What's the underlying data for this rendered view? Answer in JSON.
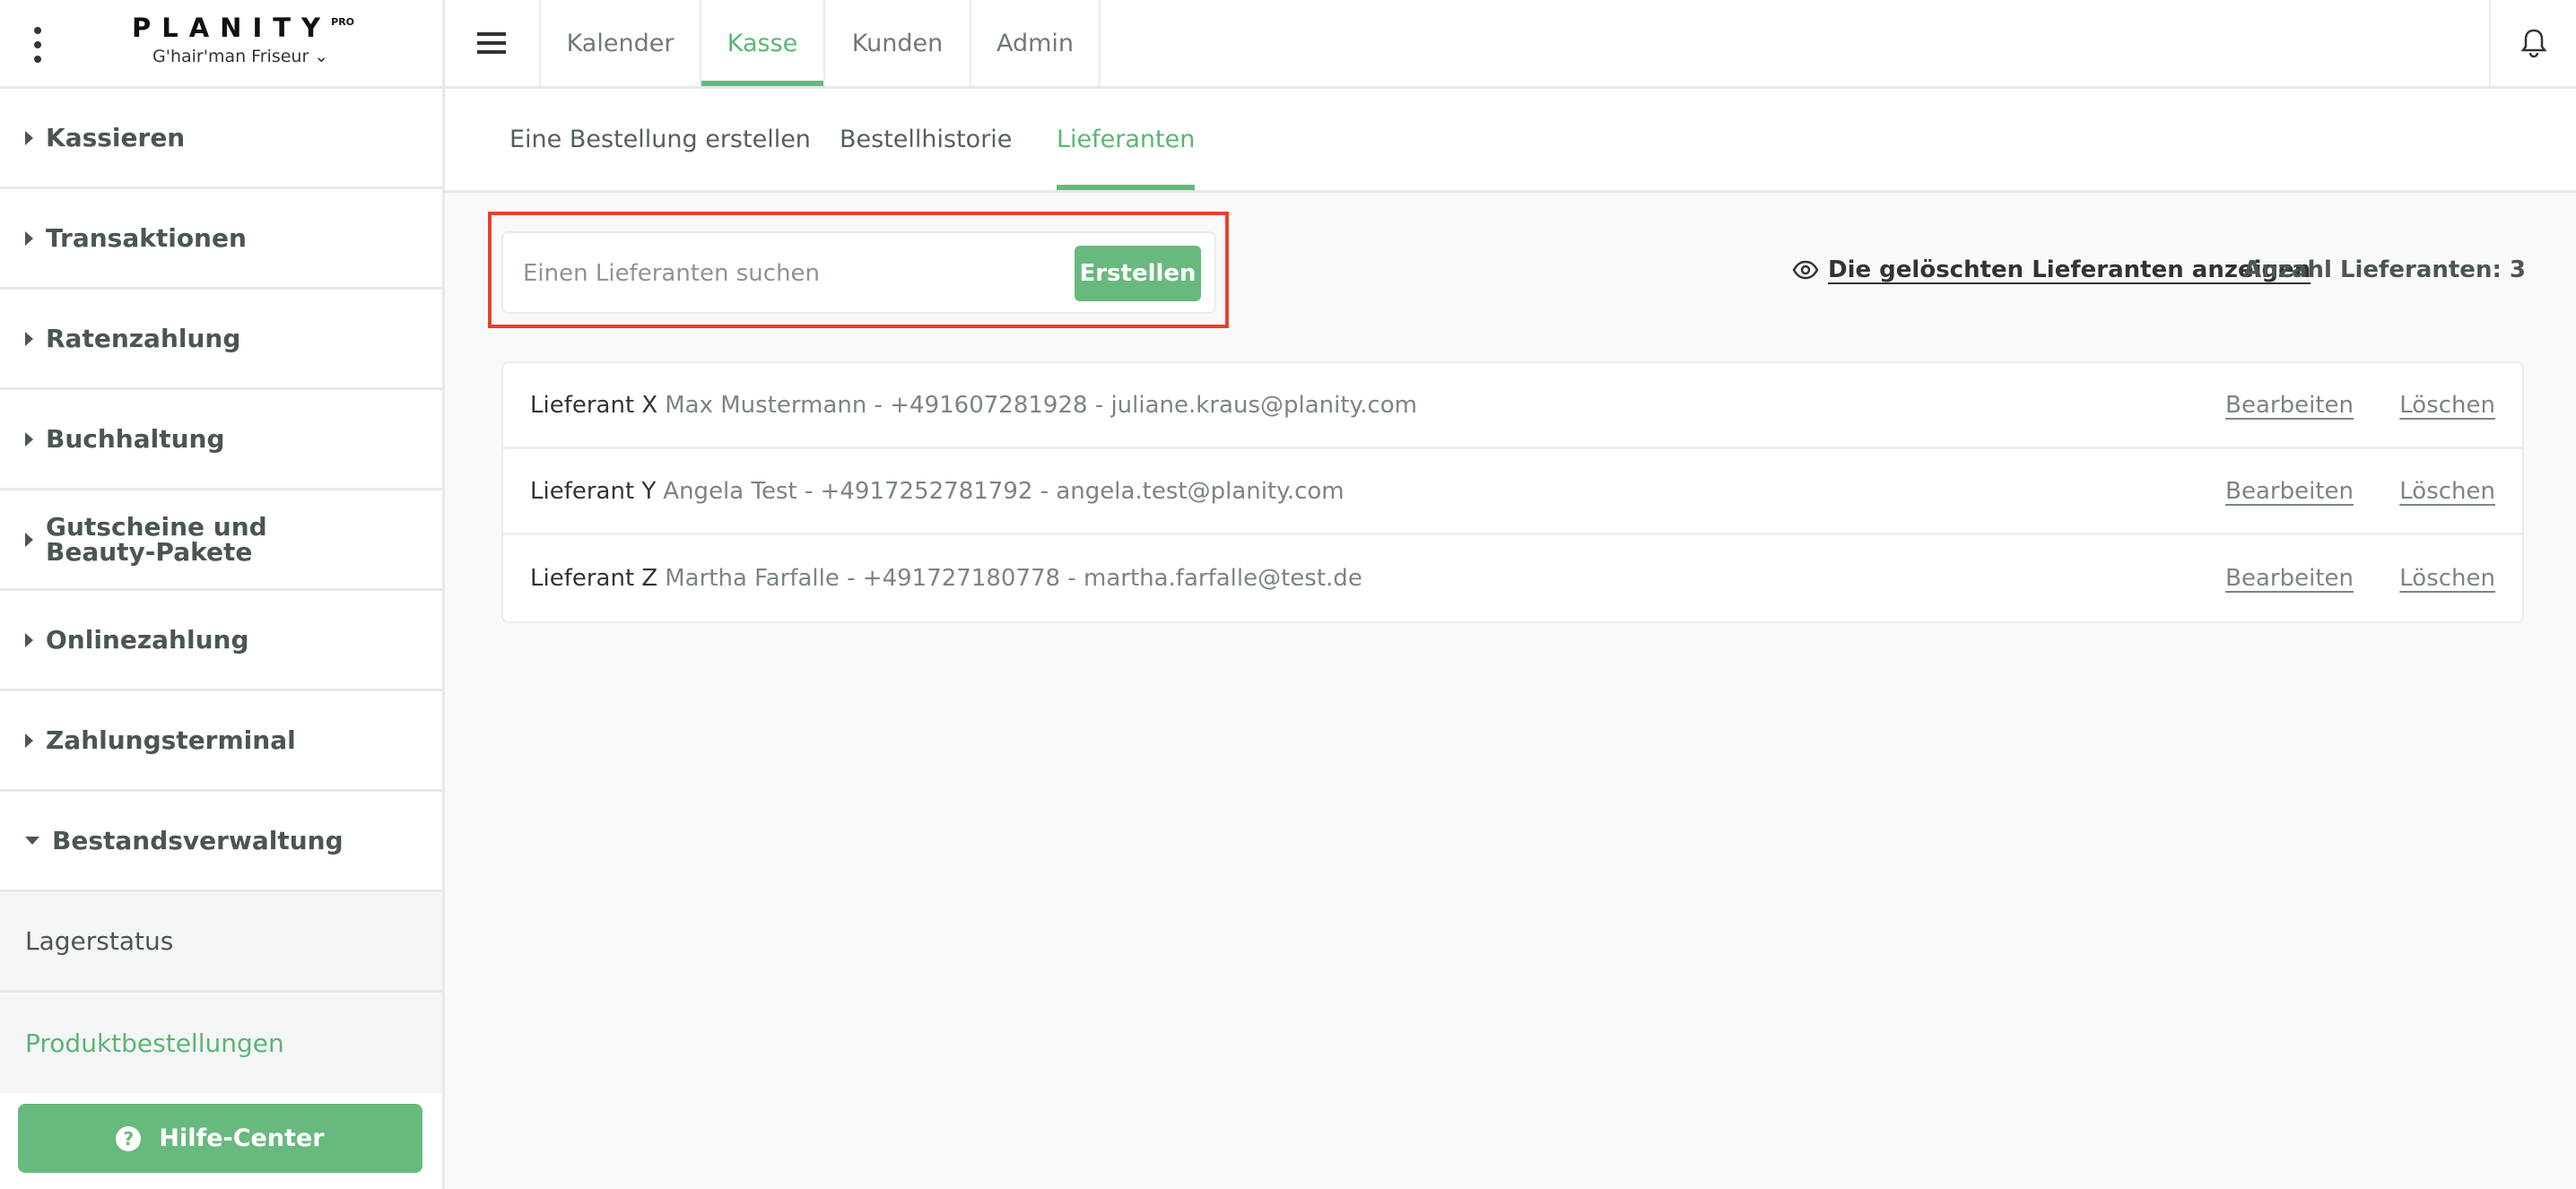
{
  "brand": {
    "logo": "PLANITY",
    "logo_sup": "PRO",
    "salon": "G'hair'man Friseur ⌄"
  },
  "topnav": {
    "tabs": [
      "Kalender",
      "Kasse",
      "Kunden",
      "Admin"
    ],
    "active": "Kasse"
  },
  "sidebar": {
    "items": [
      "Kassieren",
      "Transaktionen",
      "Ratenzahlung",
      "Buchhaltung",
      "Gutscheine und Beauty-Pakete",
      "Onlinezahlung",
      "Zahlungsterminal",
      "Bestandsverwaltung"
    ],
    "subitems": [
      "Lagerstatus",
      "Produktbestellungen"
    ],
    "help": "Hilfe-Center"
  },
  "subtabs": [
    "Eine Bestellung erstellen",
    "Bestellhistorie",
    "Lieferanten"
  ],
  "search": {
    "placeholder": "Einen Lieferanten suchen",
    "create": "Erstellen"
  },
  "show_deleted": "Die gelöschten Lieferanten anzeigen",
  "count": "Anzahl Lieferanten: 3",
  "suppliers": [
    {
      "name": "Lieferant X",
      "info": "Max Mustermann - +491607281928 - juliane.kraus@planity.com"
    },
    {
      "name": "Lieferant Y",
      "info": "Angela Test - +4917252781792 - angela.test@planity.com"
    },
    {
      "name": "Lieferant Z",
      "info": "Martha Farfalle - +491727180778 - martha.farfalle@test.de"
    }
  ],
  "actions": {
    "edit": "Bearbeiten",
    "delete": "Löschen"
  },
  "colors": {
    "accent": "#68b97e",
    "highlight": "#e5432d"
  }
}
